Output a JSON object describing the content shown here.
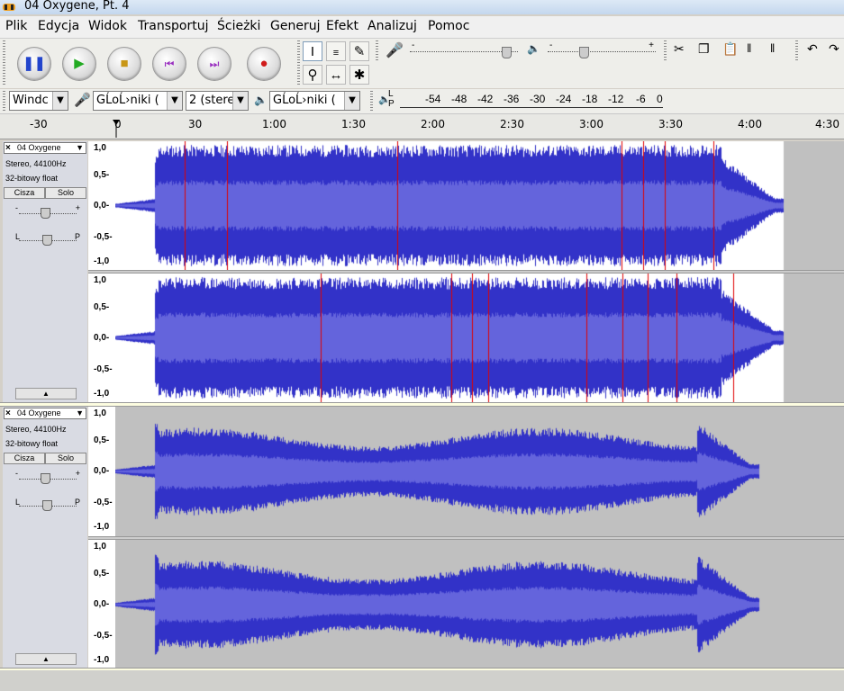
{
  "window": {
    "title": "04 Oxygene, Pt. 4"
  },
  "menu": {
    "items": [
      "Plik",
      "Edycja",
      "Widok",
      "Transportuj",
      "Ścieżki",
      "Generuj",
      "Efekt",
      "Analizuj",
      "Pomoc"
    ]
  },
  "transport": {
    "pause_icon": "pause-icon",
    "play_icon": "play-icon",
    "stop_icon": "stop-icon",
    "skip_start_icon": "skip-start-icon",
    "skip_end_icon": "skip-end-icon",
    "record_icon": "record-icon"
  },
  "meters": {
    "mic_slider_minus": "-",
    "mic_slider_plus": "+",
    "out_slider_minus": "-",
    "out_slider_plus": "+",
    "mic_level": 0.93,
    "out_level": 0.32
  },
  "device": {
    "host": "Windc",
    "input": "GĹoĹ›niki (",
    "channels": "2 (stere",
    "output": "GĹoĹ›niki (",
    "vu_l": "L",
    "vu_p": "P",
    "vu_scale": [
      "-54",
      "-48",
      "-42",
      "-36",
      "-30",
      "-24",
      "-18",
      "-12",
      "-6",
      "0"
    ]
  },
  "ruler": {
    "labels": [
      "-30",
      "0",
      "30",
      "1:00",
      "1:30",
      "2:00",
      "2:30",
      "3:00",
      "3:30",
      "4:00",
      "4:30"
    ]
  },
  "tracks": [
    {
      "name": "04 Oxygene",
      "info1": "Stereo, 44100Hz",
      "info2": "32-bitowy float",
      "mute": "Cisza",
      "solo": "Solo",
      "gain_minus": "-",
      "gain_plus": "+",
      "pan_l": "L",
      "pan_p": "P",
      "gain_level": 0.5,
      "pan_level": 0.5,
      "scale_top": [
        "1,0",
        "0,5-",
        "0,0-",
        "-0,5-",
        "-1,0"
      ],
      "scale_bot": [
        "1,0",
        "0,5-",
        "0,0-",
        "-0,5-",
        "-1,0"
      ]
    },
    {
      "name": "04 Oxygene",
      "info1": "Stereo, 44100Hz",
      "info2": "32-bitowy float",
      "mute": "Cisza",
      "solo": "Solo",
      "gain_minus": "-",
      "gain_plus": "+",
      "pan_l": "L",
      "pan_p": "P",
      "gain_level": 0.5,
      "pan_level": 0.5,
      "scale_top": [
        "1,0",
        "0,5-",
        "0,0-",
        "-0,5-",
        "-1,0"
      ],
      "scale_bot": [
        "1,0",
        "0,5-",
        "0,0-",
        "-0,5-",
        "-1,0"
      ]
    }
  ],
  "colors": {
    "wave": "#3232c8",
    "rms": "#6464dc",
    "clip": "#e00000",
    "bg_sel": "#ffffff",
    "bg": "#c0c0c0"
  }
}
